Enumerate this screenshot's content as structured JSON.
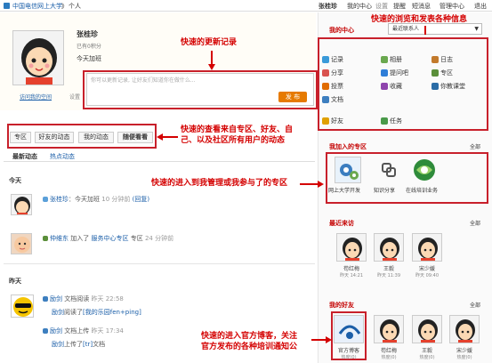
{
  "topbar": {
    "breadcrumb_site": "中国电信网上大学",
    "breadcrumb_sep": "》",
    "breadcrumb_page": "个人",
    "user_name": "张桂珍",
    "links": [
      "我的中心",
      "设置",
      "提醒",
      "短消息",
      "管理中心",
      "退出"
    ]
  },
  "profile": {
    "name": "张桂珍",
    "stat": "已有0积分",
    "today": "今天加班",
    "visit_link": "访问我的空间",
    "settings": "设置",
    "post_placeholder": "你可以更新记录, 让好友们知道你在做什么...",
    "post_button": "发 布"
  },
  "tabs": [
    "专区",
    "好友的动态",
    "我的动态",
    "随便看看"
  ],
  "subtabs": [
    "最新动态",
    "热点动态"
  ],
  "feed": {
    "today_label": "今天",
    "yesterday_label": "昨天",
    "items": [
      {
        "user": "张桂珍",
        "text": "：今天加班",
        "time": "10 分钟前",
        "extra": "(回复)"
      },
      {
        "user": "仲维东",
        "text": "加入了",
        "target": "服务中心专区",
        "text2": "专区",
        "time": "24 分钟前"
      },
      {
        "user": "励剑",
        "text": "文档阅读",
        "time": "昨天 22:58"
      },
      {
        "user": "励剑",
        "text": "阅读了",
        "target": "[我的乐园fen+ping]"
      },
      {
        "user": "励剑",
        "text": "文档上传",
        "time": "昨天 17:34"
      },
      {
        "user": "励剑",
        "text": "上传了",
        "target": "[tr]",
        "text2": "文档"
      }
    ]
  },
  "right": {
    "my_center": "我的中心",
    "select_value": "最近联系人",
    "apps": [
      {
        "label": "记录",
        "color": "#3a9ad9"
      },
      {
        "label": "相册",
        "color": "#6aa84f"
      },
      {
        "label": "日志",
        "color": "#c27a2c"
      },
      {
        "label": "分享",
        "color": "#d9534f"
      },
      {
        "label": "提问吧",
        "color": "#2f7ed8"
      },
      {
        "label": "专区",
        "color": "#5b8f3a"
      },
      {
        "label": "投票",
        "color": "#e06c00"
      },
      {
        "label": "收藏",
        "color": "#8e44ad"
      },
      {
        "label": "你教课堂",
        "color": "#2a6ca6"
      },
      {
        "label": "文档",
        "color": "#3d7fbf"
      },
      {
        "label": "好友",
        "color": "#e0a000"
      },
      {
        "label": "任务",
        "color": "#4a9a4a"
      }
    ],
    "zones_title": "我加入的专区",
    "zones_all": "全部",
    "zones": [
      "网上大学开发",
      "知识分享",
      "在线培训业务"
    ],
    "visitors_title": "最近来访",
    "visitors_all": "全部",
    "visitors": [
      {
        "name": "苟红梅",
        "time": "昨天 14:21"
      },
      {
        "name": "王毅",
        "time": "昨天 11:39"
      },
      {
        "name": "宋少媛",
        "time": "昨天 09:40"
      }
    ],
    "friends_title": "我的好友",
    "friends_all": "全部",
    "friends": [
      {
        "name": "官方博客",
        "time": "热度(0)"
      },
      {
        "name": "苟红梅",
        "time": "热度(0)"
      },
      {
        "name": "王毅",
        "time": "热度(0)"
      },
      {
        "name": "宋少媛",
        "time": "热度(0)"
      }
    ]
  },
  "annotations": {
    "a1": "快速的浏览和发表各种信息",
    "a2": "快速的更新记录",
    "a3_line1": "快速的查看来自专区、好友、自",
    "a3_line2": "己、以及社区所有用户的动态",
    "a4": "快速的进入到我管理或我参与了的专区",
    "a5_line1": "快速的进入官方博客，关注",
    "a5_line2": "官方发布的各种培训通知公"
  },
  "colors": {
    "accent": "#d40000",
    "button": "#e67a00",
    "link": "#1a5ea8"
  }
}
